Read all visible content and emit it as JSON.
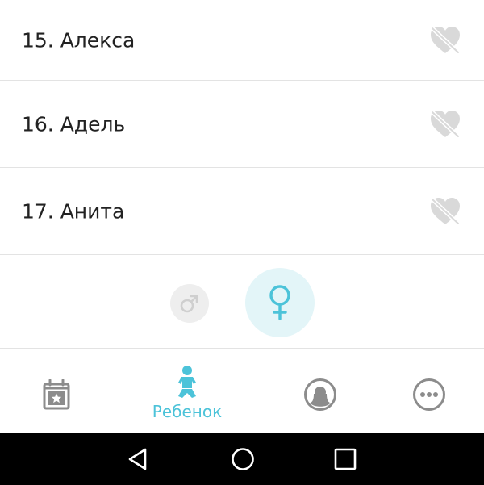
{
  "names": [
    {
      "label": "15. Алекса"
    },
    {
      "label": "16. Адель"
    },
    {
      "label": "17. Анита"
    }
  ],
  "gender": {
    "selected": "female",
    "male_icon": "male-symbol-icon",
    "female_icon": "female-symbol-icon"
  },
  "nav": {
    "calendar_icon": "calendar-star-icon",
    "baby_icon": "baby-icon",
    "baby_label": "Ребенок",
    "profile_icon": "profile-icon",
    "more_icon": "more-icon"
  },
  "colors": {
    "accent": "#4cc3d9",
    "icon_gray": "#8c8c8c",
    "heart_gray": "#d9d9d9"
  }
}
